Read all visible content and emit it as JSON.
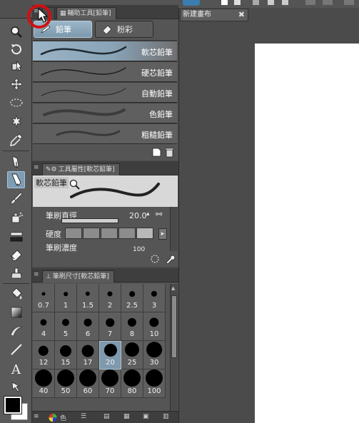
{
  "canvas": {
    "doc_tab_label": "新建畫布"
  },
  "subtool_palette": {
    "tab_label": "輔助工具[鉛筆]",
    "groups": [
      {
        "label": "鉛筆"
      },
      {
        "label": "粉彩"
      }
    ],
    "items": [
      {
        "label": "軟芯鉛筆"
      },
      {
        "label": "硬芯鉛筆"
      },
      {
        "label": "自動鉛筆"
      },
      {
        "label": "色鉛筆"
      },
      {
        "label": "粗糙鉛筆"
      }
    ]
  },
  "tool_property": {
    "tab_label": "工具屬性[軟芯鉛筆]",
    "preview_name": "軟芯鉛筆",
    "brush_size_label": "筆刷直徑",
    "brush_size_value": "20.0",
    "hardness_label": "硬度",
    "density_label": "筆刷濃度",
    "density_value": "100"
  },
  "brush_size_palette": {
    "tab_label": "筆刷尺寸[軟芯鉛筆]",
    "sizes": [
      "0.7",
      "1",
      "1.5",
      "2",
      "2.5",
      "3",
      "4",
      "5",
      "6",
      "7",
      "8",
      "10",
      "12",
      "15",
      "17",
      "20",
      "25",
      "30",
      "40",
      "50",
      "60",
      "70",
      "80",
      "100"
    ],
    "selected": "20"
  },
  "bottom_bar": {
    "color_label": "色"
  },
  "colors": {
    "accent": "#7f99ad",
    "panel": "#555555",
    "highlight_circle": "#d01010"
  }
}
